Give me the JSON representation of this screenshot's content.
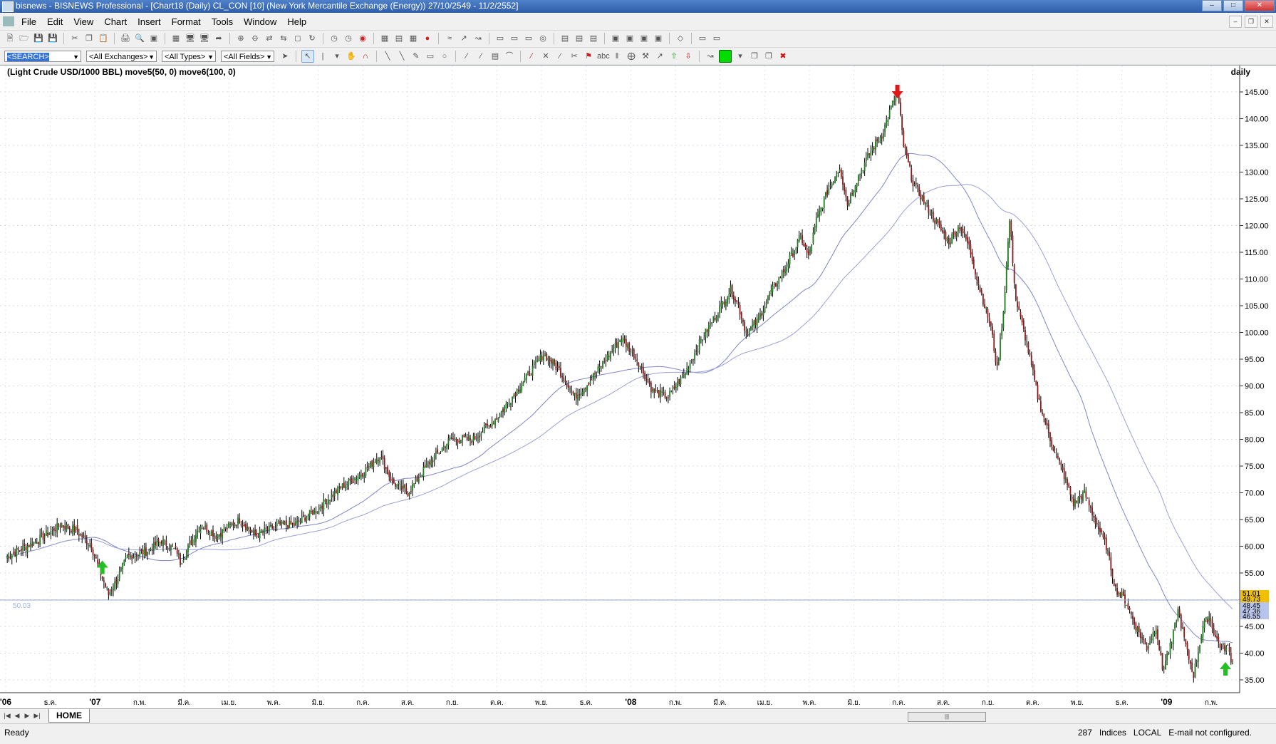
{
  "window": {
    "title": "bisnews - BISNEWS Professional - [Chart18 (Daily)  CL_CON [10] (New York Mercantile Exchange (Energy)) 27/10/2549 - 11/2/2552]"
  },
  "menu": [
    "File",
    "Edit",
    "View",
    "Chart",
    "Insert",
    "Format",
    "Tools",
    "Window",
    "Help"
  ],
  "toolbar2": {
    "search": "<SEARCH>",
    "exchanges": "<All Exchanges>",
    "types": "<All Types>",
    "fields": "<All Fields>"
  },
  "chart": {
    "legend": "(Light Crude USD/1000 BBL) move5(50, 0) move6(100, 0)",
    "period": "daily",
    "hline_label": "50.03",
    "last_price_labels": [
      "51.01",
      "49.73",
      "48.45",
      "47.36",
      "46.55"
    ],
    "colors": {
      "up": "#1f7a1f",
      "down": "#8b1a1a",
      "ma": "#7e86c8",
      "arrow_buy": "#22c022",
      "arrow_sell": "#e01818",
      "last_tag": "#f0c000"
    }
  },
  "chart_data": {
    "type": "candlestick",
    "y_tick_labels": [
      "145.00",
      "140.00",
      "135.00",
      "130.00",
      "125.00",
      "120.00",
      "115.00",
      "110.00",
      "105.00",
      "100.00",
      "95.00",
      "90.00",
      "85.00",
      "80.00",
      "75.00",
      "70.00",
      "65.00",
      "60.00",
      "55.00",
      "50.00",
      "45.00",
      "40.00",
      "35.00"
    ],
    "ylim": [
      32,
      148
    ],
    "x_tick_labels": [
      "'06",
      "ธ.ค.",
      "'07",
      "ก.พ.",
      "มี.ค.",
      "เม.ย.",
      "พ.ค.",
      "มิ.ย.",
      "ก.ค.",
      "ส.ค.",
      "ก.ย.",
      "ต.ค.",
      "พ.ย.",
      "ธ.ค.",
      "'08",
      "ก.พ.",
      "มี.ค.",
      "เม.ย.",
      "พ.ค.",
      "มิ.ย.",
      "ก.ค.",
      "ส.ค.",
      "ก.ย.",
      "ต.ค.",
      "พ.ย.",
      "ธ.ค.",
      "'09",
      "ก.พ."
    ],
    "date_range": [
      "27/10/2549",
      "11/2/2552"
    ],
    "approx_close_path": [
      [
        0,
        58
      ],
      [
        20,
        61
      ],
      [
        35,
        64
      ],
      [
        45,
        63
      ],
      [
        55,
        60
      ],
      [
        62,
        54
      ],
      [
        66,
        51
      ],
      [
        70,
        53
      ],
      [
        78,
        58
      ],
      [
        90,
        59
      ],
      [
        100,
        61
      ],
      [
        110,
        59
      ],
      [
        112,
        57
      ],
      [
        125,
        64
      ],
      [
        135,
        62
      ],
      [
        150,
        65
      ],
      [
        160,
        62
      ],
      [
        175,
        64
      ],
      [
        185,
        64
      ],
      [
        200,
        67
      ],
      [
        215,
        71
      ],
      [
        230,
        74
      ],
      [
        240,
        77
      ],
      [
        248,
        72
      ],
      [
        258,
        70
      ],
      [
        270,
        75
      ],
      [
        285,
        80
      ],
      [
        300,
        80
      ],
      [
        315,
        84
      ],
      [
        330,
        90
      ],
      [
        345,
        96
      ],
      [
        355,
        93
      ],
      [
        365,
        88
      ],
      [
        375,
        91
      ],
      [
        385,
        95
      ],
      [
        395,
        99
      ],
      [
        405,
        95
      ],
      [
        415,
        89
      ],
      [
        425,
        88
      ],
      [
        435,
        92
      ],
      [
        445,
        98
      ],
      [
        455,
        103
      ],
      [
        465,
        108
      ],
      [
        470,
        105
      ],
      [
        475,
        100
      ],
      [
        482,
        102
      ],
      [
        490,
        107
      ],
      [
        500,
        112
      ],
      [
        510,
        118
      ],
      [
        515,
        114
      ],
      [
        520,
        121
      ],
      [
        528,
        127
      ],
      [
        535,
        131
      ],
      [
        540,
        124
      ],
      [
        545,
        128
      ],
      [
        555,
        134
      ],
      [
        562,
        137
      ],
      [
        568,
        142
      ],
      [
        572,
        145
      ],
      [
        576,
        135
      ],
      [
        582,
        128
      ],
      [
        590,
        124
      ],
      [
        598,
        120
      ],
      [
        605,
        117
      ],
      [
        612,
        120
      ],
      [
        618,
        116
      ],
      [
        625,
        108
      ],
      [
        632,
        101
      ],
      [
        636,
        93
      ],
      [
        640,
        104
      ],
      [
        644,
        121
      ],
      [
        648,
        106
      ],
      [
        655,
        98
      ],
      [
        662,
        88
      ],
      [
        670,
        80
      ],
      [
        678,
        74
      ],
      [
        685,
        68
      ],
      [
        692,
        70
      ],
      [
        700,
        64
      ],
      [
        706,
        60
      ],
      [
        712,
        52
      ],
      [
        718,
        50
      ],
      [
        725,
        45
      ],
      [
        732,
        41
      ],
      [
        738,
        45
      ],
      [
        742,
        37
      ],
      [
        748,
        42
      ],
      [
        752,
        48
      ],
      [
        758,
        40
      ],
      [
        762,
        36
      ],
      [
        768,
        45
      ],
      [
        772,
        47
      ],
      [
        776,
        43
      ],
      [
        780,
        41
      ],
      [
        784,
        41
      ],
      [
        787,
        38
      ]
    ],
    "series": [
      {
        "name": "move5(50, 0)"
      },
      {
        "name": "move6(100, 0)"
      }
    ],
    "signals": [
      {
        "type": "buy",
        "date": "ม.ค. '07",
        "price": 56
      },
      {
        "type": "sell",
        "date": "ก.ค. '08",
        "price": 147
      },
      {
        "type": "buy",
        "date": "ก.พ. '09",
        "price": 37
      }
    ]
  },
  "tabs": {
    "home": "HOME"
  },
  "status": {
    "ready": "Ready",
    "count": "287",
    "indices": "Indices",
    "local": "LOCAL",
    "email": "E-mail not configured."
  }
}
